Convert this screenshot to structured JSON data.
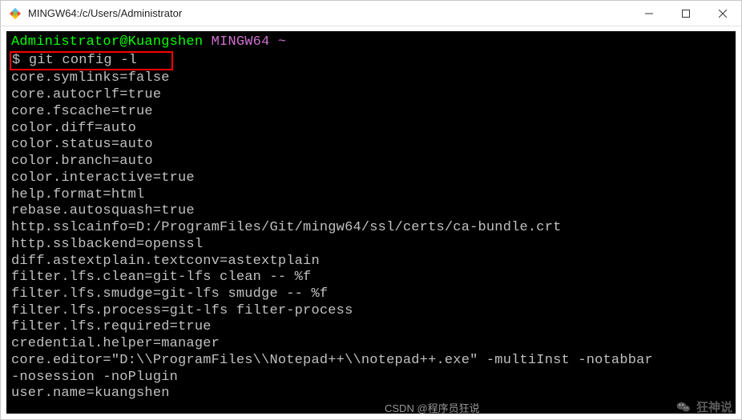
{
  "titlebar": {
    "title": "MINGW64:/c/Users/Administrator"
  },
  "terminal": {
    "prompt_user": "Administrator@Kuangshen",
    "prompt_sys": "MINGW64",
    "prompt_path": "~",
    "prompt_symbol": "$",
    "command": "git config -l",
    "output": [
      "core.symlinks=false",
      "core.autocrlf=true",
      "core.fscache=true",
      "color.diff=auto",
      "color.status=auto",
      "color.branch=auto",
      "color.interactive=true",
      "help.format=html",
      "rebase.autosquash=true",
      "http.sslcainfo=D:/ProgramFiles/Git/mingw64/ssl/certs/ca-bundle.crt",
      "http.sslbackend=openssl",
      "diff.astextplain.textconv=astextplain",
      "filter.lfs.clean=git-lfs clean -- %f",
      "filter.lfs.smudge=git-lfs smudge -- %f",
      "filter.lfs.process=git-lfs filter-process",
      "filter.lfs.required=true",
      "credential.helper=manager",
      "core.editor=\"D:\\\\ProgramFiles\\\\Notepad++\\\\notepad++.exe\" -multiInst -notabbar ",
      "-nosession -noPlugin",
      "user.name=kuangshen"
    ]
  },
  "watermark": {
    "left": "CSDN @程序员狂说",
    "right": "狂神说"
  }
}
